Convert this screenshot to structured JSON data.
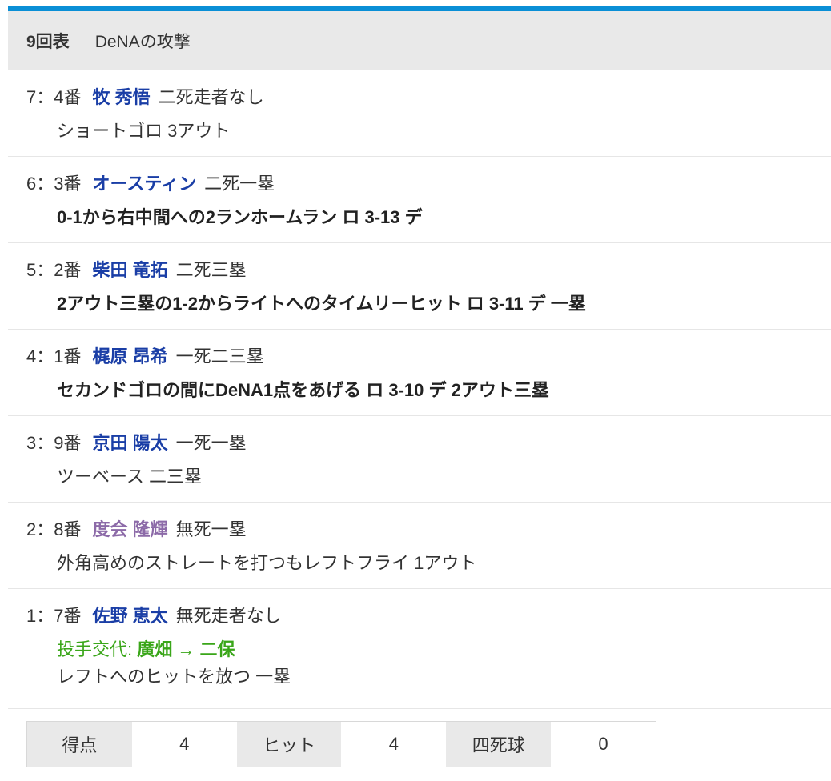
{
  "header": {
    "inning": "9回表",
    "team": "DeNAの攻撃"
  },
  "events": [
    {
      "num": "7：4番",
      "player": "牧 秀悟",
      "situation": "二死走者なし",
      "result": "ショートゴロ 3アウト",
      "bold": false
    },
    {
      "num": "6：3番",
      "player": "オースティン",
      "situation": "二死一塁",
      "result": "0-1から右中間への2ランホームラン ロ 3-13 デ",
      "bold": true
    },
    {
      "num": "5：2番",
      "player": "柴田 竜拓",
      "situation": "二死三塁",
      "result": "2アウト三塁の1-2からライトへのタイムリーヒット ロ 3-11 デ 一塁",
      "bold": true
    },
    {
      "num": "4：1番",
      "player": "梶原 昂希",
      "situation": "一死二三塁",
      "result": "セカンドゴロの間にDeNA1点をあげる ロ 3-10 デ 2アウト三塁",
      "bold": true
    },
    {
      "num": "3：9番",
      "player": "京田 陽太",
      "situation": "一死一塁",
      "result": "ツーベース 二三塁",
      "bold": false
    },
    {
      "num": "2：8番",
      "player": "度会 隆輝",
      "situation": "無死一塁",
      "result": "外角高めのストレートを打つもレフトフライ 1アウト",
      "bold": false
    },
    {
      "num": "1：7番",
      "player": "佐野 恵太",
      "situation": "無死走者なし",
      "change_label": "投手交代:",
      "change_detail": "廣畑 → 二保",
      "result": "レフトへのヒットを放つ 一塁",
      "bold": false
    }
  ],
  "stats": [
    {
      "label": "得点",
      "value": "4"
    },
    {
      "label": "ヒット",
      "value": "4"
    },
    {
      "label": "四死球",
      "value": "0"
    }
  ],
  "colors": {
    "accent_bar": "#0a8fd6",
    "player": "#1a3ea6",
    "rookie_player": "#8c6aa8",
    "pitcher_change": "#3aa619"
  }
}
